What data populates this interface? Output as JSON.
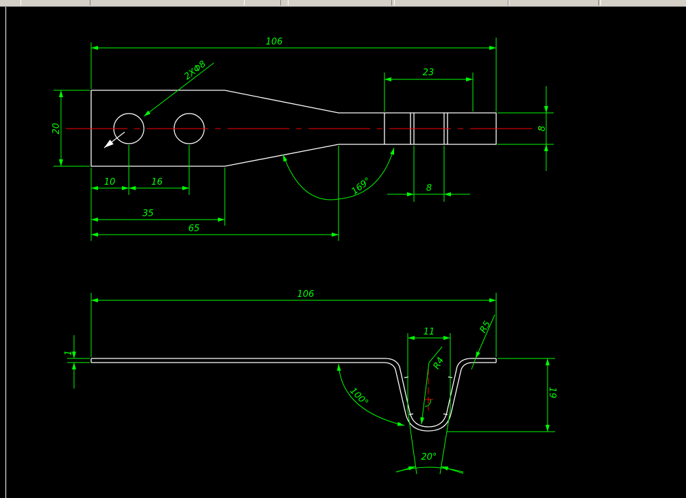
{
  "colors": {
    "background": "#000000",
    "geometry": "#ffffff",
    "dimension": "#00ff00",
    "centerline": "#ff0000"
  },
  "top_view": {
    "overall_length": "106",
    "hole_callout": "2XΦ8",
    "width_left": "20",
    "slot_length": "23",
    "tab_width": "8",
    "hole1_pos": "10",
    "hole_pitch": "16",
    "taper_start": "35",
    "taper_end": "65",
    "taper_angle": "169°",
    "slot_width": "8"
  },
  "side_view": {
    "overall_length": "106",
    "thickness": "1",
    "channel_width": "11",
    "outer_radius": "R5",
    "inner_radius": "R4",
    "flange_angle": "100°",
    "channel_depth": "19",
    "wall_angle": "20°"
  }
}
